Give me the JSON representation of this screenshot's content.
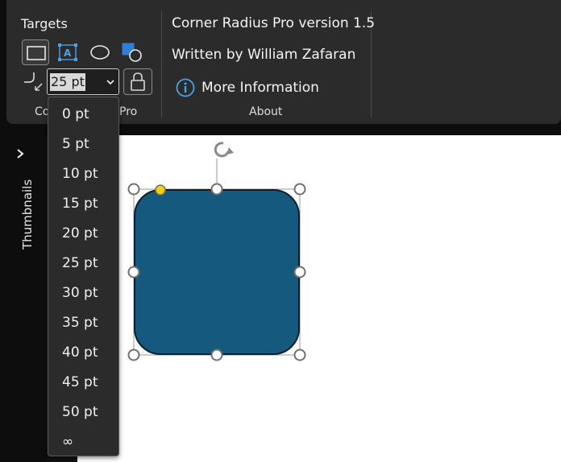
{
  "ribbon": {
    "targets_group": {
      "title": "Targets",
      "label_left": "Co",
      "label_right": "Pro",
      "radius_value": "25 pt",
      "icons": [
        "rectangle-shape-icon",
        "textbox-shape-icon",
        "ellipse-shape-icon",
        "group-shapes-icon"
      ]
    },
    "about_group": {
      "title_line": "Corner Radius Pro version 1.5",
      "author_line": "Written by William Zafaran",
      "more_info_label": "More Information",
      "label": "About"
    }
  },
  "dropdown": {
    "options": [
      "0 pt",
      "5 pt",
      "10 pt",
      "15 pt",
      "20 pt",
      "25 pt",
      "30 pt",
      "35 pt",
      "40 pt",
      "45 pt",
      "50 pt",
      "∞"
    ]
  },
  "sidebar": {
    "label": "Thumbnails"
  },
  "colors": {
    "shape_fill": "#155a7e",
    "adjust_handle": "#f5d000",
    "ribbon_bg": "#2b2b2b",
    "info_icon": "#4aa3e8"
  }
}
